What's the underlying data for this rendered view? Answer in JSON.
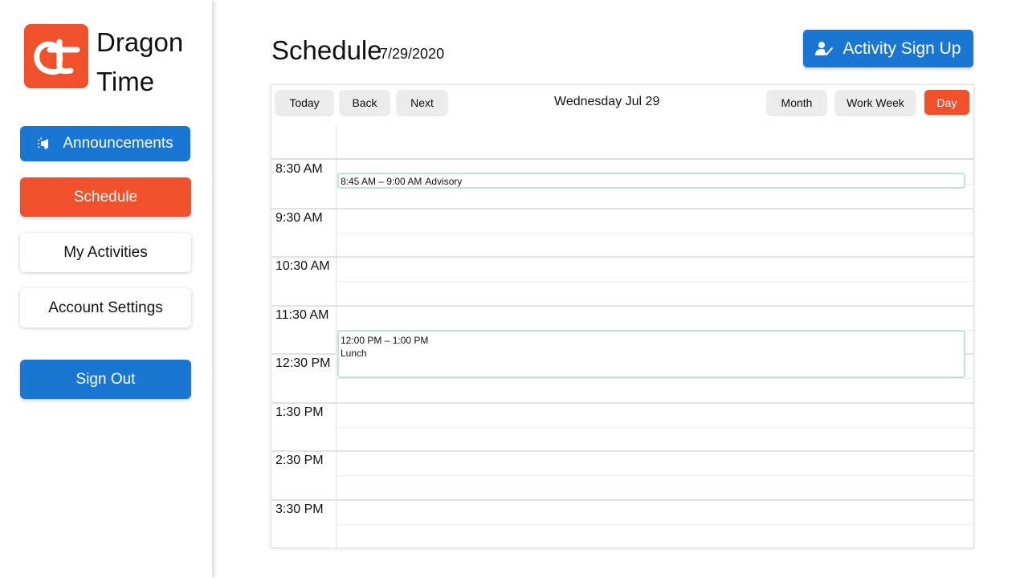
{
  "brand": {
    "line1": "Dragon",
    "line2": "Time",
    "logo_color": "#f0502a"
  },
  "nav": {
    "announcements": "Announcements",
    "schedule": "Schedule",
    "my_activities": "My Activities",
    "account_settings": "Account Settings",
    "sign_out": "Sign Out"
  },
  "header": {
    "title": "Schedule",
    "date": "7/29/2020",
    "signup_label": "Activity Sign Up"
  },
  "toolbar": {
    "today": "Today",
    "back": "Back",
    "next": "Next",
    "label": "Wednesday Jul 29",
    "month": "Month",
    "work_week": "Work Week",
    "day": "Day",
    "active_view": "Day"
  },
  "time_slots": [
    "8:30 AM",
    "9:30 AM",
    "10:30 AM",
    "11:30 AM",
    "12:30 PM",
    "1:30 PM",
    "2:30 PM",
    "3:30 PM"
  ],
  "events": {
    "advisory": {
      "time": "8:45 AM – 9:00 AM",
      "title": "Advisory"
    },
    "lunch": {
      "time": "12:00 PM – 1:00 PM",
      "title": "Lunch"
    }
  },
  "colors": {
    "primary_blue": "#1976d2",
    "accent_orange": "#f0502a",
    "event_border": "#c3e2d6"
  },
  "icons": {
    "announcements": "megaphone-icon",
    "signup": "user-check-icon"
  }
}
